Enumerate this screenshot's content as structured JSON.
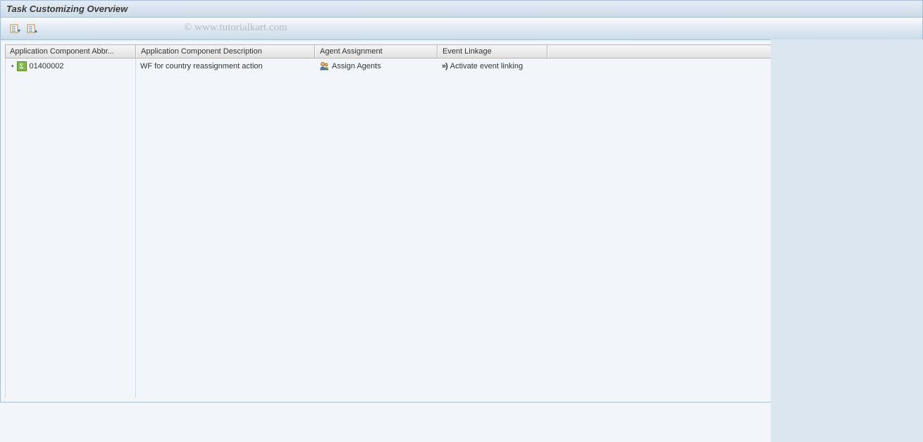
{
  "title": "Task Customizing Overview",
  "watermark": "© www.tutorialkart.com",
  "toolbar": {
    "expand_icon": "expand-subtree",
    "collapse_icon": "collapse-subtree"
  },
  "columns": {
    "abbr": "Application Component Abbr...",
    "desc": "Application Component Description",
    "agent": "Agent Assignment",
    "event": "Event Linkage"
  },
  "rows": [
    {
      "abbr": "01400002",
      "desc": "WF for country reassignment action",
      "agent": "Assign Agents",
      "event": "Activate event linking"
    }
  ]
}
